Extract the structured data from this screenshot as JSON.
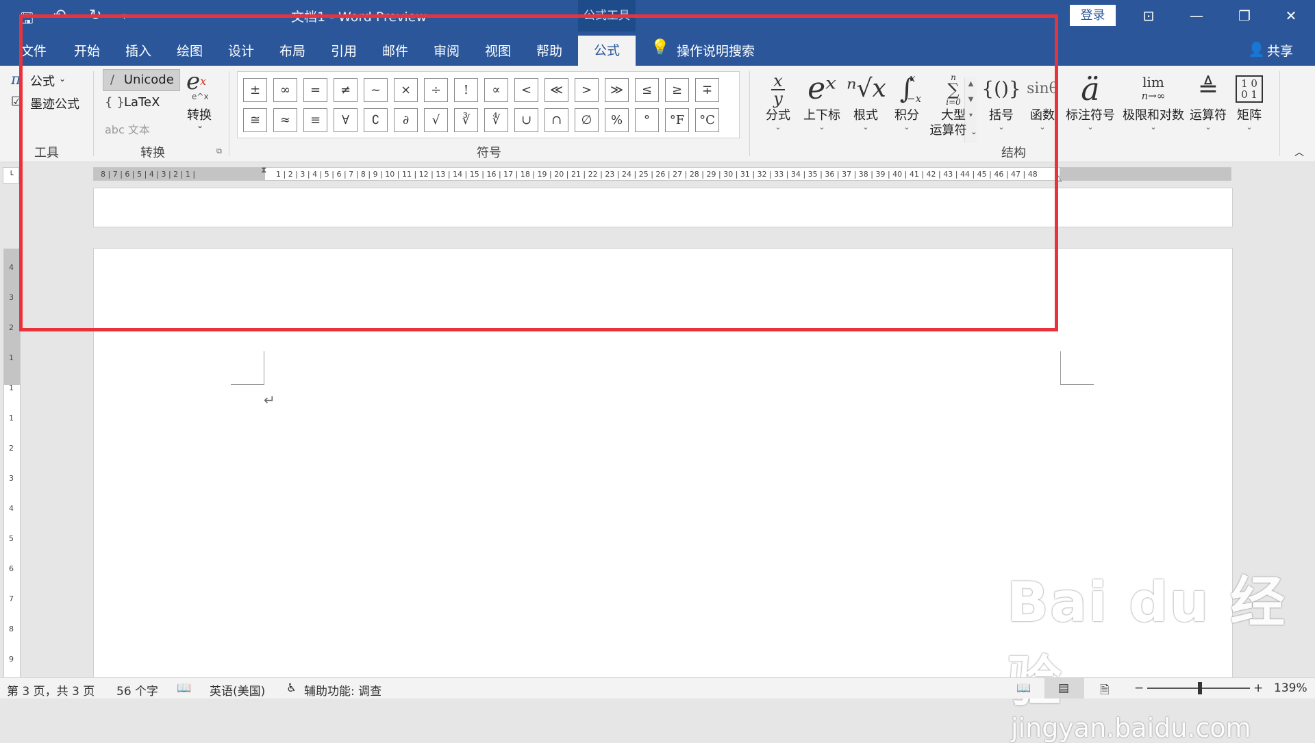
{
  "titlebar": {
    "title": "文档1  -  Word Preview",
    "context_tab": "公式工具",
    "login": "登录"
  },
  "menubar": {
    "tabs": [
      "文件",
      "开始",
      "插入",
      "绘图",
      "设计",
      "布局",
      "引用",
      "邮件",
      "审阅",
      "视图",
      "帮助"
    ],
    "active_tab": "公式",
    "tell_me": "操作说明搜索",
    "share": "共享"
  },
  "ribbon": {
    "tools": {
      "equation": "公式",
      "ink_equation": "墨迹公式",
      "label": "工具"
    },
    "conversion": {
      "unicode": "Unicode",
      "latex": "LaTeX",
      "text": "abc 文本",
      "convert": "转换",
      "convert_icon_sub": "e^x",
      "label": "转换"
    },
    "symbols": {
      "label": "符号",
      "row1": [
        "±",
        "∞",
        "=",
        "≠",
        "~",
        "×",
        "÷",
        "!",
        "∝",
        "<",
        "≪",
        ">",
        "≫",
        "≤",
        "≥",
        "∓"
      ],
      "row2": [
        "≅",
        "≈",
        "≡",
        "∀",
        "∁",
        "∂",
        "√",
        "∛",
        "∜",
        "∪",
        "∩",
        "∅",
        "%",
        "°",
        "°F",
        "°C"
      ]
    },
    "structures": {
      "label": "结构",
      "items": [
        {
          "label": "分式"
        },
        {
          "label": "上下标"
        },
        {
          "label": "根式"
        },
        {
          "label": "积分"
        },
        {
          "label": "大型",
          "label2": "运算符"
        },
        {
          "label": "括号"
        },
        {
          "label": "函数"
        },
        {
          "label": "标注符号"
        },
        {
          "label": "极限和对数"
        },
        {
          "label": "运算符"
        },
        {
          "label": "矩阵"
        }
      ],
      "icons": {
        "fraction_num": "x",
        "fraction_den": "y",
        "script": "eˣ",
        "radical": "ⁿ√x",
        "integral": "∫",
        "integral_sup": "x",
        "integral_sub": "−x",
        "largeop": "∑",
        "largeop_sup": "n",
        "largeop_sub": "i=0",
        "bracket": "{()}",
        "function": "sinθ",
        "accent": "ä",
        "limit_top": "lim",
        "limit_bottom": "n→∞",
        "operator": "≜",
        "matrix": "[1 0; 0 1]"
      }
    }
  },
  "ruler": {
    "left_numbers": "8 | 7 | 6 | 5 | 4 | 3 | 2 | 1 |",
    "right_numbers": "1 | 2 | 3 | 4 | 5 | 6 | 7 | 8 | 9 | 10 | 11 | 12 | 13 | 14 | 15 | 16 | 17 | 18 | 19 | 20 | 21 | 22 | 23 | 24 | 25 | 26 | 27 | 28 | 29 | 30 | 31 | 32 | 33 | 34 | 35 | 36 | 37 | 38 | 39 | 40 | 41 | 42 | 43 | 44 | 45 | 46 | 47 | 48",
    "vertical_numbers": [
      "4",
      "3",
      "2",
      "1",
      "1",
      "1",
      "2",
      "3",
      "4",
      "5",
      "6",
      "7",
      "8",
      "9"
    ]
  },
  "document": {
    "paragraph_mark": "↵"
  },
  "statusbar": {
    "page": "第 3 页，共 3 页",
    "words": "56 个字",
    "language": "英语(美国)",
    "accessibility": "辅助功能: 调查",
    "zoom": "139%",
    "zoom_minus": "−",
    "zoom_plus": "+"
  },
  "watermark": {
    "brand": "Bai du 经验",
    "url": "jingyan.baidu.com"
  },
  "colors": {
    "accent": "#2b579a",
    "highlight": "#e8333c"
  }
}
